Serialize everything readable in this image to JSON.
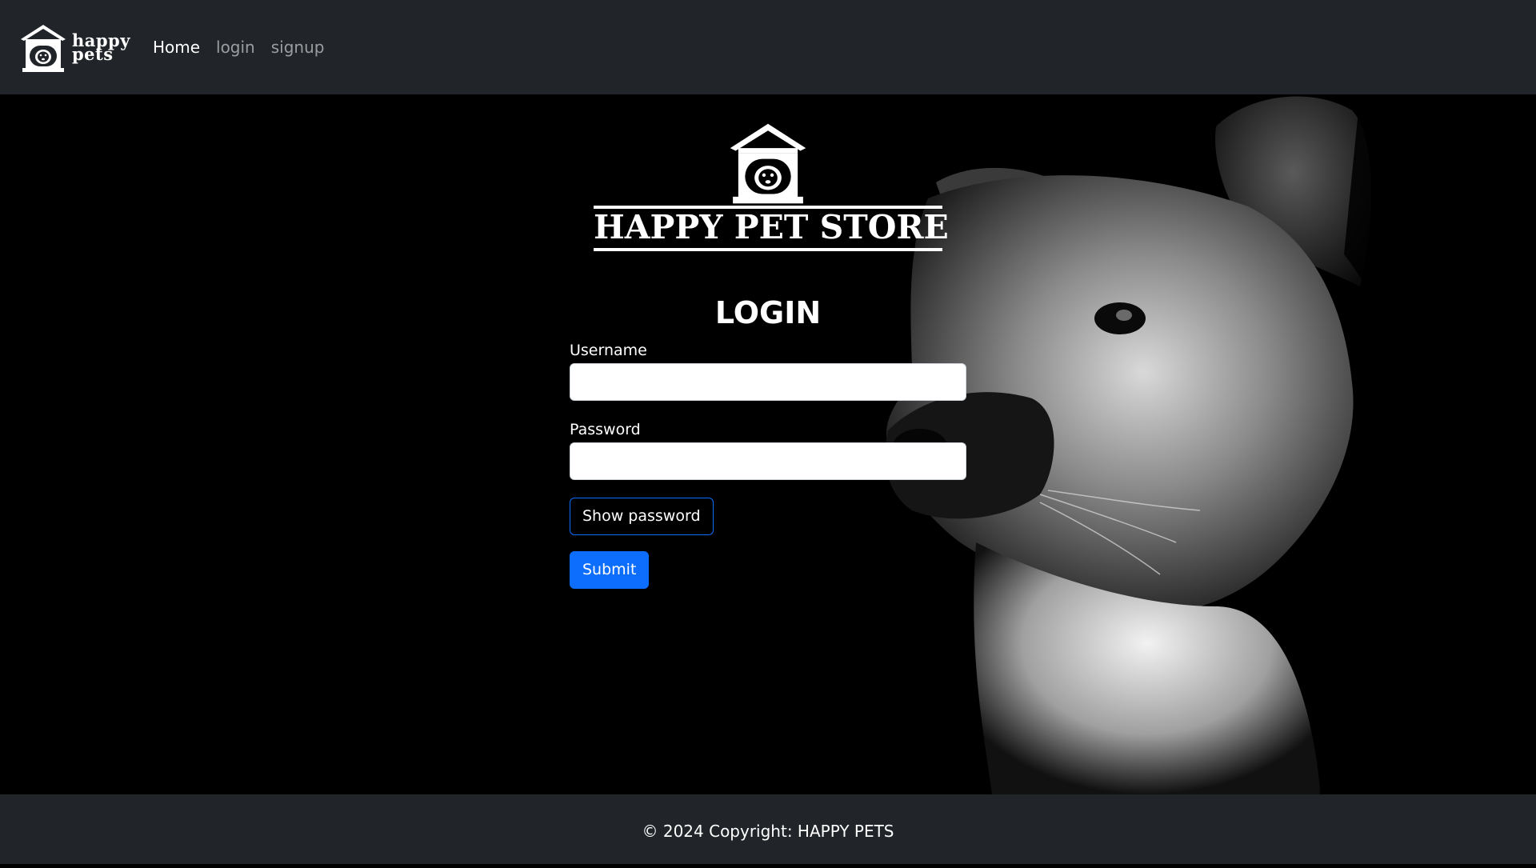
{
  "navbar": {
    "brand_line1": "happy",
    "brand_line2": "pets",
    "links": [
      {
        "label": "Home",
        "active": true
      },
      {
        "label": "login",
        "active": false
      },
      {
        "label": "signup",
        "active": false
      }
    ]
  },
  "hero": {
    "store_name": "HAPPY PET STORE",
    "form": {
      "title": "LOGIN",
      "username_label": "Username",
      "username_value": "",
      "password_label": "Password",
      "password_value": "",
      "show_password_label": "Show password",
      "submit_label": "Submit"
    }
  },
  "footer": {
    "copyright": "© 2024 Copyright: HAPPY PETS"
  },
  "colors": {
    "navbar_bg": "#212529",
    "primary": "#0d6efd",
    "page_bg": "#000000"
  },
  "icons": [
    "doghouse-logo-icon",
    "dog-photo-background"
  ]
}
